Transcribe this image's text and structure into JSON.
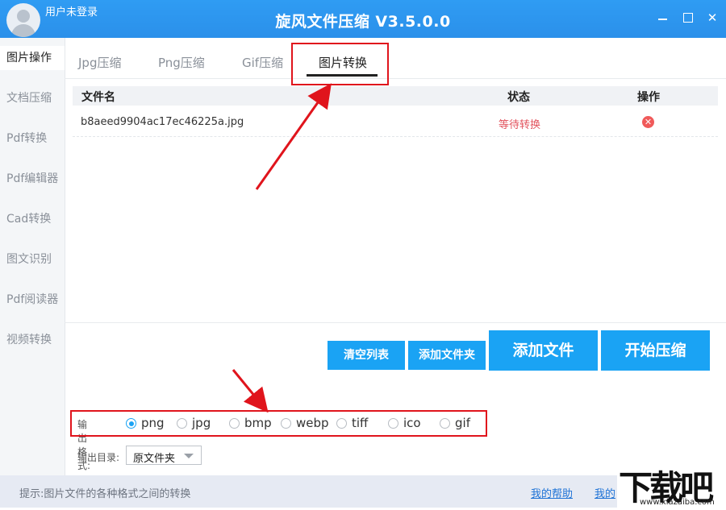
{
  "window": {
    "user_label": "用户未登录",
    "title": "旋风文件压缩 V3.5.0.0",
    "minimize_glyph": "—",
    "close_glyph": "✕"
  },
  "sidebar": {
    "items": [
      {
        "label": "图片操作"
      },
      {
        "label": "文档压缩"
      },
      {
        "label": "Pdf转换"
      },
      {
        "label": "Pdf编辑器"
      },
      {
        "label": "Cad转换"
      },
      {
        "label": "图文识别"
      },
      {
        "label": "Pdf阅读器"
      },
      {
        "label": "视频转换"
      }
    ],
    "active_index": 0
  },
  "tabs": [
    {
      "label": "Jpg压缩"
    },
    {
      "label": "Png压缩"
    },
    {
      "label": "Gif压缩"
    },
    {
      "label": "图片转换"
    }
  ],
  "table": {
    "headers": {
      "name": "文件名",
      "status": "状态",
      "action": "操作"
    },
    "rows": [
      {
        "name": "b8aeed9904ac17ec46225a.jpg",
        "status": "等待转换",
        "action_icon": "delete-icon"
      }
    ]
  },
  "buttons": {
    "clear": "清空列表",
    "add_folder": "添加文件夹",
    "add_file": "添加文件",
    "start": "开始压缩"
  },
  "output_format": {
    "label": "输出格式:",
    "options": [
      "png",
      "jpg",
      "bmp",
      "webp",
      "tiff",
      "ico",
      "gif"
    ],
    "selected": "png"
  },
  "output_dir": {
    "label": "输出目录:",
    "value": "原文件夹"
  },
  "statusbar": {
    "hint": "提示:图片文件的各种格式之间的转换",
    "help_link": "我的帮助",
    "other_link": "我的"
  },
  "watermark": {
    "text": "下载吧",
    "url": "www.xiazaiba.com"
  },
  "colors": {
    "titlebar": "#2f9cf3",
    "button": "#1aa3f4",
    "annotation": "#e0141c",
    "status_text": "#e2535d"
  }
}
